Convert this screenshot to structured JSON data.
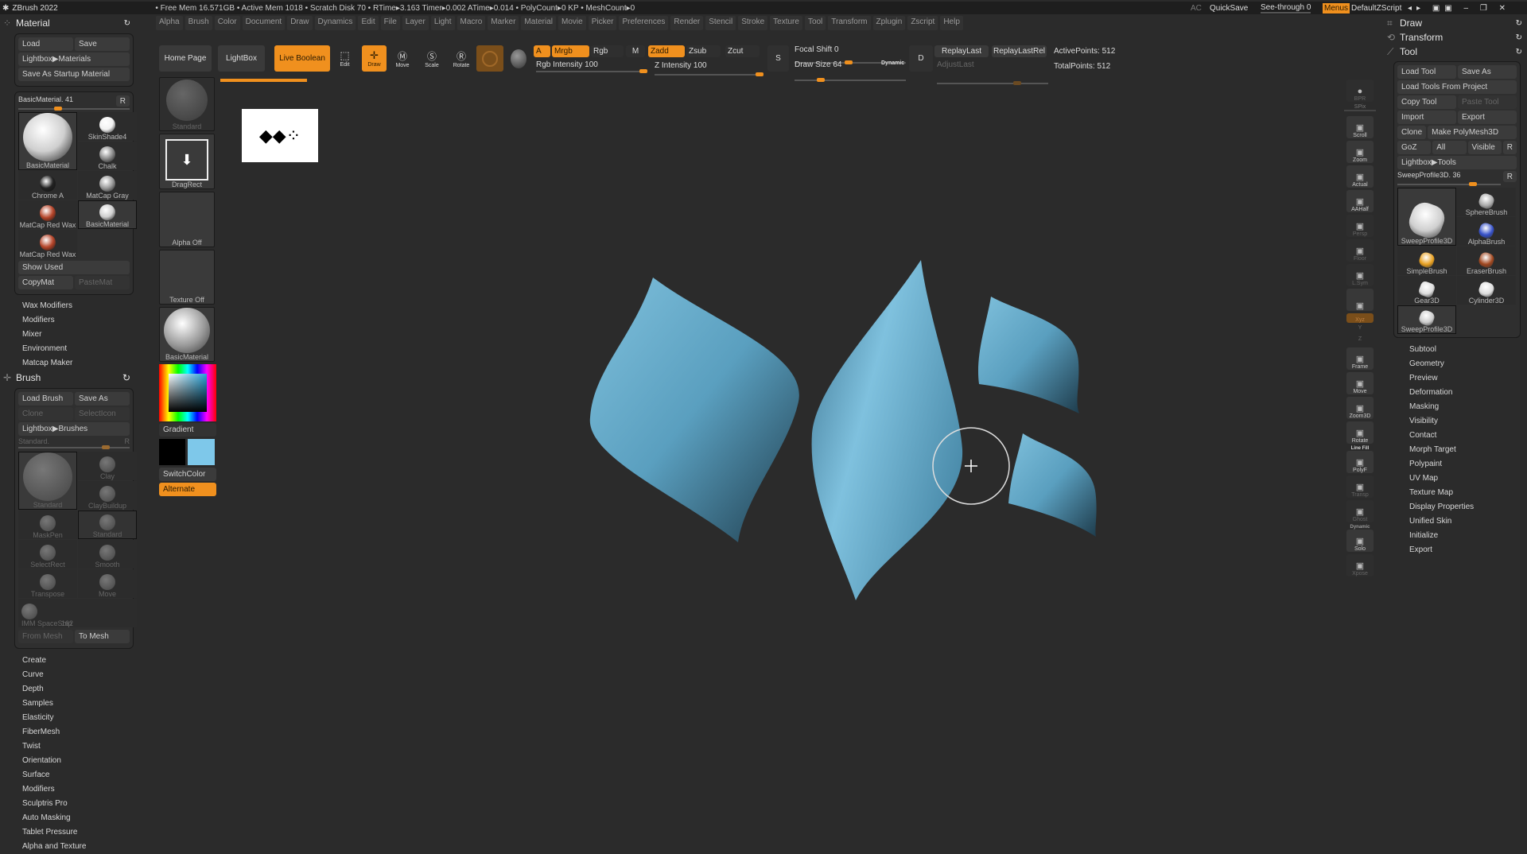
{
  "titlebar": {
    "app": "ZBrush 2022",
    "status": "• Free Mem 16.571GB • Active Mem 1018 • Scratch Disk 70 • RTime▸3.163 Timer▸0.002 ATime▸0.014 • PolyCount▸0 KP • MeshCount▸0",
    "ac": "AC",
    "quicksave": "QuickSave",
    "see_through": "See-through 0",
    "menus": "Menus",
    "script": "DefaultZScript"
  },
  "menus": [
    "Alpha",
    "Brush",
    "Color",
    "Document",
    "Draw",
    "Dynamics",
    "Edit",
    "File",
    "Layer",
    "Light",
    "Macro",
    "Marker",
    "Material",
    "Movie",
    "Picker",
    "Preferences",
    "Render",
    "Stencil",
    "Stroke",
    "Texture",
    "Tool",
    "Transform",
    "Zplugin",
    "Zscript",
    "Help"
  ],
  "material": {
    "title": "Material",
    "load": "Load",
    "save": "Save",
    "lightbox": "Lightbox▶Materials",
    "save_startup": "Save As Startup Material",
    "slider": "BasicMaterial. 41",
    "r": "R",
    "items": [
      {
        "name": "BasicMaterial",
        "color": "#cfcfcf"
      },
      {
        "name": "SkinShade4",
        "color": "#f2f2f2"
      },
      {
        "name": "Chalk",
        "color": "#8a8a8a"
      },
      {
        "name": "Chrome A",
        "color": "#222222"
      },
      {
        "name": "MatCap Gray",
        "color": "#9a9a9a"
      },
      {
        "name": "MatCap Red Wax",
        "color": "#b5452a"
      },
      {
        "name": "BasicMaterial",
        "color": "#cfcfcf"
      },
      {
        "name": "MatCap Red Wax",
        "color": "#b5452a"
      }
    ],
    "show_used": "Show Used",
    "copymat": "CopyMat",
    "pastemat": "PasteMat",
    "subs": [
      "Wax Modifiers",
      "Modifiers",
      "Mixer",
      "Environment",
      "Matcap Maker"
    ]
  },
  "brush": {
    "title": "Brush",
    "load": "Load Brush",
    "save": "Save As",
    "clone": "Clone",
    "selecticon": "SelectIcon",
    "lightbox": "Lightbox▶Brushes",
    "slider": "Standard.",
    "r": "R",
    "items": [
      "Standard",
      "Clay",
      "ClayBuildup",
      "MaskPen",
      "Standard",
      "SelectRect",
      "Smooth",
      "Transpose",
      "Move",
      "IMM SpaceShip"
    ],
    "imm_count": "162",
    "from_mesh": "From Mesh",
    "to_mesh": "To Mesh",
    "subs": [
      "Create",
      "Curve",
      "Depth",
      "Samples",
      "Elasticity",
      "FiberMesh",
      "Twist",
      "Orientation",
      "Surface",
      "Modifiers",
      "Sculptris Pro",
      "Auto Masking",
      "Tablet Pressure",
      "Alpha and Texture"
    ]
  },
  "toolbar": {
    "home": "Home Page",
    "lightbox": "LightBox",
    "live_boolean": "Live Boolean",
    "edit": "Edit",
    "draw": "Draw",
    "move": "Move",
    "scale": "Scale",
    "rotate": "Rotate",
    "a": "A",
    "mrgb": "Mrgb",
    "rgb": "Rgb",
    "m": "M",
    "zadd": "Zadd",
    "zsub": "Zsub",
    "zcut": "Zcut",
    "rgb_intensity": "Rgb Intensity 100",
    "z_intensity": "Z Intensity 100",
    "focal_shift": "Focal Shift 0",
    "draw_size": "Draw Size 64",
    "dynamic": "Dynamic",
    "replay_last": "ReplayLast",
    "replay_last_rel": "ReplayLastRel",
    "adjust_last": "AdjustLast",
    "active_points": "ActivePoints: 512",
    "total_points": "TotalPoints: 512",
    "s": "S",
    "d": "D"
  },
  "shelf": {
    "brush": "Standard",
    "stroke": "DragRect",
    "alpha": "Alpha Off",
    "texture": "Texture Off",
    "material": "BasicMaterial",
    "gradient": "Gradient",
    "switch": "SwitchColor",
    "alternate": "Alternate",
    "main_color": "#000000",
    "secondary_color": "#7ec8ea"
  },
  "right_shelf": [
    "BPR",
    "SPix",
    "Scroll",
    "Zoom",
    "Actual",
    "AAHalf",
    "Persp",
    "Floor",
    "L.Sym",
    "",
    "Xyz",
    "Y",
    "Z",
    "Frame",
    "Move",
    "Zoom3D",
    "Rotate",
    "PolyF",
    "Transp",
    "Ghost",
    "Solo",
    "Xpose"
  ],
  "right_shelf_extra": {
    "linefill": "Line Fill",
    "dynamic": "Dynamic"
  },
  "tool": {
    "draw": "Draw",
    "transform": "Transform",
    "title": "Tool",
    "load": "Load Tool",
    "save": "Save As",
    "load_project": "Load Tools From Project",
    "copy": "Copy Tool",
    "paste": "Paste Tool",
    "import": "Import",
    "export": "Export",
    "clone": "Clone",
    "make_poly": "Make PolyMesh3D",
    "goz": "GoZ",
    "all": "All",
    "visible": "Visible",
    "r": "R",
    "lightbox": "Lightbox▶Tools",
    "slider": "SweepProfile3D. 36",
    "items": [
      "SweepProfile3D",
      "SphereBrush",
      "AlphaBrush",
      "SimpleBrush",
      "EraserBrush",
      "Gear3D",
      "Cylinder3D",
      "SweepProfile3D"
    ],
    "subs": [
      "Subtool",
      "Geometry",
      "Preview",
      "Deformation",
      "Masking",
      "Visibility",
      "Contact",
      "Morph Target",
      "Polypaint",
      "UV Map",
      "Texture Map",
      "Display Properties",
      "Unified Skin",
      "Initialize",
      "Export"
    ]
  },
  "colors": {
    "accent": "#f0901e",
    "mesh": "#5fa6c6"
  }
}
